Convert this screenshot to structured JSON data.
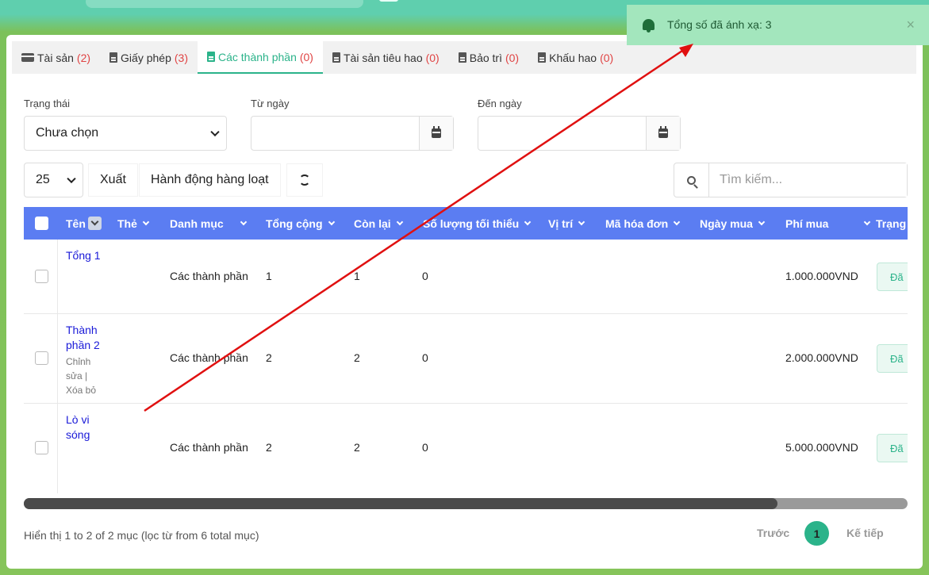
{
  "tabs": [
    {
      "label": "Tài sản",
      "count": "(2)",
      "icon": "credit-card-icon"
    },
    {
      "label": "Giấy phép",
      "count": "(3)",
      "icon": "file-icon"
    },
    {
      "label": "Các thành phần",
      "count": "(0)",
      "icon": "file-icon",
      "active": true
    },
    {
      "label": "Tài sản tiêu hao",
      "count": "(0)",
      "icon": "file-icon"
    },
    {
      "label": "Bảo trì",
      "count": "(0)",
      "icon": "file-icon"
    },
    {
      "label": "Khấu hao",
      "count": "(0)",
      "icon": "file-icon"
    }
  ],
  "filters": {
    "status_label": "Trạng thái",
    "status_value": "Chưa chọn",
    "from_label": "Từ ngày",
    "to_label": "Đến ngày"
  },
  "toolbar": {
    "page_size": "25",
    "export": "Xuất",
    "bulk": "Hành động hàng loạt",
    "search_placeholder": "Tìm kiếm..."
  },
  "columns": [
    "Tên",
    "Thẻ",
    "Danh mục",
    "Tổng cộng",
    "Còn lại",
    "Số lượng tối thiểu",
    "Vị trí",
    "Mã hóa đơn",
    "Ngày mua",
    "Phí mua",
    "Trạng"
  ],
  "rows": [
    {
      "name": "Tổng 1",
      "category": "Các thành phần",
      "total": "1",
      "remaining": "1",
      "min": "0",
      "cost": "1.000.000VND",
      "status": "Đã"
    },
    {
      "name": "Thành phần 2",
      "actions": "Chỉnh sửa | Xóa bỏ",
      "category": "Các thành phần",
      "total": "2",
      "remaining": "2",
      "min": "0",
      "cost": "2.000.000VND",
      "status": "Đã"
    },
    {
      "name": "Lò vi sóng",
      "category": "Các thành phần",
      "total": "2",
      "remaining": "2",
      "min": "0",
      "cost": "5.000.000VND",
      "status": "Đã"
    }
  ],
  "footer": {
    "info": "Hiển thị 1 to 2 of 2 mục (lọc từ from 6 total mục)",
    "prev": "Trước",
    "page": "1",
    "next": "Kế tiếp"
  },
  "toast": {
    "text": "Tổng số đã ánh xạ: 3",
    "close": "×"
  },
  "colors": {
    "accent": "#2bb38a",
    "header": "#5b7df2",
    "annotation": "#e01010"
  }
}
